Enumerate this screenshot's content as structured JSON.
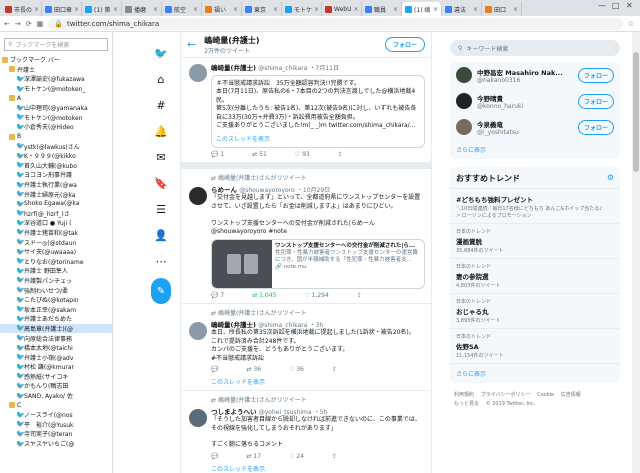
{
  "browser": {
    "tabs": [
      {
        "label": "市長の",
        "color": "#c0392b"
      },
      {
        "label": "田口章",
        "color": "#3b82f6"
      },
      {
        "label": "(1) 第",
        "color": "#1da1f2"
      },
      {
        "label": "播磨",
        "color": "#888888"
      },
      {
        "label": "航空",
        "color": "#3b82f6"
      },
      {
        "label": "福い",
        "color": "#e67e22"
      },
      {
        "label": "東京",
        "color": "#3b82f6"
      },
      {
        "label": "モトケ",
        "color": "#1da1f2"
      },
      {
        "label": "WebU",
        "color": "#c0392b"
      },
      {
        "label": "職員",
        "color": "#3b82f6"
      },
      {
        "label": "(1) 嶋",
        "color": "#1da1f2"
      },
      {
        "label": "違法",
        "color": "#3b82f6"
      },
      {
        "label": "田口",
        "color": "#e67e22"
      }
    ],
    "active_tab": 10,
    "window_controls": [
      "—",
      "□",
      "✕"
    ],
    "url": "twitter.com/shima_chikara"
  },
  "bookmarks": {
    "search_placeholder": "ブックマークを検索",
    "rows": [
      {
        "label": "ブックマーク バー",
        "folder": true,
        "indent": 0
      },
      {
        "label": "弁護士",
        "folder": true,
        "indent": 1
      },
      {
        "label": "深澤諭史(@fukazawa",
        "indent": 2
      },
      {
        "label": "モトケン(@motoken_",
        "indent": 2
      },
      {
        "label": "A",
        "folder": true,
        "indent": 1
      },
      {
        "label": "山中理司(@yamanaka",
        "indent": 2
      },
      {
        "label": "モトケン(@motoken",
        "indent": 2
      },
      {
        "label": "小倉秀夫(@Hideo",
        "indent": 2
      },
      {
        "label": "B",
        "folder": true,
        "indent": 1
      },
      {
        "label": "ystk(@lawkus)さん",
        "indent": 2
      },
      {
        "label": "K・９９９(@kikko",
        "indent": 2
      },
      {
        "label": "首久山大輔(@kubo",
        "indent": 2
      },
      {
        "label": "ヨコヨン刑事弁護",
        "indent": 2
      },
      {
        "label": "弁護士執行業(@wa",
        "indent": 2
      },
      {
        "label": "弁護士婦原元(@ka",
        "indent": 2
      },
      {
        "label": "Shoko Egawa(@ka",
        "indent": 2
      },
      {
        "label": "hzrf(@_hzrf_)さ",
        "indent": 2
      },
      {
        "label": "深谷道口 ● Yuji (",
        "indent": 2
      },
      {
        "label": "弁護士猪苗和(@tak",
        "indent": 2
      },
      {
        "label": "スドー◎(@stdaun",
        "indent": 2
      },
      {
        "label": "サイ夫(@uwaaaa)",
        "indent": 2
      },
      {
        "label": "とりなお(@toriname",
        "indent": 2
      },
      {
        "label": "弁護士 野田隼人",
        "indent": 2
      },
      {
        "label": "弁護製パンチェッ",
        "indent": 2
      },
      {
        "label": "強制わいせつ/柔",
        "indent": 2
      },
      {
        "label": "こたぴぬ(@kotapin",
        "indent": 2
      },
      {
        "label": "坂本正幸(@sakam",
        "indent": 2
      },
      {
        "label": "弁護士あだちめた",
        "indent": 2
      },
      {
        "label": "高島章(弁護士)(@",
        "indent": 2,
        "selected": true
      },
      {
        "label": "向原総合法律事務",
        "indent": 2
      },
      {
        "label": "橋本太地(@taichi",
        "indent": 2
      },
      {
        "label": "弁護士小嶺(@adv",
        "indent": 2
      },
      {
        "label": "村松 謙(@kmurar",
        "indent": 2
      },
      {
        "label": "感熱紙(サイコキ",
        "indent": 2
      },
      {
        "label": "かもんり(鴨志田",
        "indent": 2
      },
      {
        "label": "SANO, Ayako/ 佐",
        "indent": 2
      },
      {
        "label": "C",
        "folder": true,
        "indent": 1
      },
      {
        "label": "ノースライ(@nos",
        "indent": 2
      },
      {
        "label": "平　裕介(@Yusuk",
        "indent": 2
      },
      {
        "label": "寺司実子(@teran",
        "indent": 2
      },
      {
        "label": "スヤスヤいちご(@",
        "indent": 2
      }
    ]
  },
  "profile_header": {
    "name": "嶋崎量(弁護士)",
    "tweet_count": "2万件のツイート",
    "follow_label": "フォロー"
  },
  "tweets": [
    {
      "retweet_label": "",
      "name": "嶋崎量(弁護士)",
      "handle": "@shima_chikara",
      "date": "・7月11日",
      "body": "＃不当懲戒請求訴訟　35万全額認容判決!!完勝です。\n本日(7月11日)、原告私の6・7本目の2つの判決言渡しでした@横浜地裁4民。\n第5次(分離したうち: 被告1名)、第12次(被告9名)に対し、いずれも被告各自に33万(30万+弁費3万)・訴訟費用被告全額負担。\nご支援ありがとうございました!m(_ _)m twitter.com/shima_chikara/...",
      "link": "twitter.com/shima_chikara/...",
      "show_thread": "このスレッドを表示",
      "replies": "1",
      "retweets": "51",
      "likes": "93",
      "avatar": "#6b7a8a"
    },
    {
      "retweet_label": "嶋崎量(弁護士)さんがリツイート",
      "name": "らめーん",
      "handle": "@shouwayoroyoro",
      "date": "・10月29日",
      "body": "「交付金を見越します」といって、全都道府県にワンストップセンターを設置させて、いざ設置したら「お金は削減しますよ」はあまりにひどい。\n\nワンストップ支援センターへの交付金が削減された|らめーん\n@shouwayoroyoro #note",
      "card_title": "ワンストップ支援センターへの交付金が削減された|ら...",
      "card_desc": "性犯罪・性暴力被害者ワンストップ支援センターの運営費につき、国が半額補助する「性犯罪・性暴力被害者支...",
      "card_site": "note.mu",
      "show_thread": "",
      "replies": "7",
      "retweets": "1,045",
      "likes": "1,294",
      "avatar": "#2a2a2a"
    },
    {
      "retweet_label": "嶋崎量(弁護士)さんがリツイート",
      "name": "嶋崎量(弁護士)",
      "handle": "@shima_chikara",
      "date": "・3h",
      "body": "本日、所長私の第35次訴訟を横浜地裁に提起しました(1訴状・被告20名)。\nこれで提訴済み合計248件です。\nカンパのご支援を、どうもありがとうございます。\n#不当懲戒請求訴訟",
      "show_thread": "このスレッドを表示",
      "replies": "",
      "retweets": "36",
      "likes": "36",
      "avatar": "#6b7a8a"
    },
    {
      "retweet_label": "嶋崎量(弁護士)さんがリツイート",
      "name": "つしまようへい",
      "handle": "@yohei_tsushima",
      "date": "・5h",
      "body": "「そうした加害者目線から脱却しなければ前進できないのに、この事業では、その視線を強化してしまうおそれがあります」\n\nすごく腑に落ちるコメント",
      "show_thread": "このスレッドを表示",
      "replies": "",
      "retweets": "17",
      "likes": "24",
      "avatar": "#5a6b7a"
    }
  ],
  "right": {
    "search_placeholder": "キーワード検索",
    "who_to_follow": [
      {
        "name": "中野昌宏 Masahiro Nak...",
        "handle": "@nakano0316",
        "button": "フォロー",
        "color": "#3a4a3a"
      },
      {
        "name": "今野晴貴",
        "handle": "@konno_haruki",
        "button": "フォロー",
        "color": "#222222"
      },
      {
        "name": "今泉義竜",
        "handle": "@i_yoshitatsu",
        "button": "フォロー",
        "color": "#7a6a5a"
      }
    ],
    "more_label": "さらに表示",
    "trends_title": "おすすめトレンド",
    "trends": [
      {
        "context": "",
        "name": "#どちもち強料プレゼント",
        "desc": "＼10日間連続／毎日17名様にどちもち あんこ&ホイップ当たる♪",
        "meta": "ローソンによるプロモーション"
      },
      {
        "context": "日本のトレンド",
        "name": "漫画賞脱",
        "meta": "35,684件のツイート"
      },
      {
        "context": "日本のトレンド",
        "name": "妻の参院選",
        "meta": "4,803件のツイート"
      },
      {
        "context": "日本のトレンド",
        "name": "おじゃる丸",
        "meta": "3,893件のツイート"
      },
      {
        "context": "日本のトレンド",
        "name": "佐野SA",
        "meta": "11,154件のツイート"
      }
    ],
    "trends_more": "さらに表示",
    "footer": [
      "利用規約",
      "プライバシーポリシー",
      "Cookie",
      "広告情報",
      "もっと見る",
      "© 2019 Twitter, Inc."
    ]
  }
}
